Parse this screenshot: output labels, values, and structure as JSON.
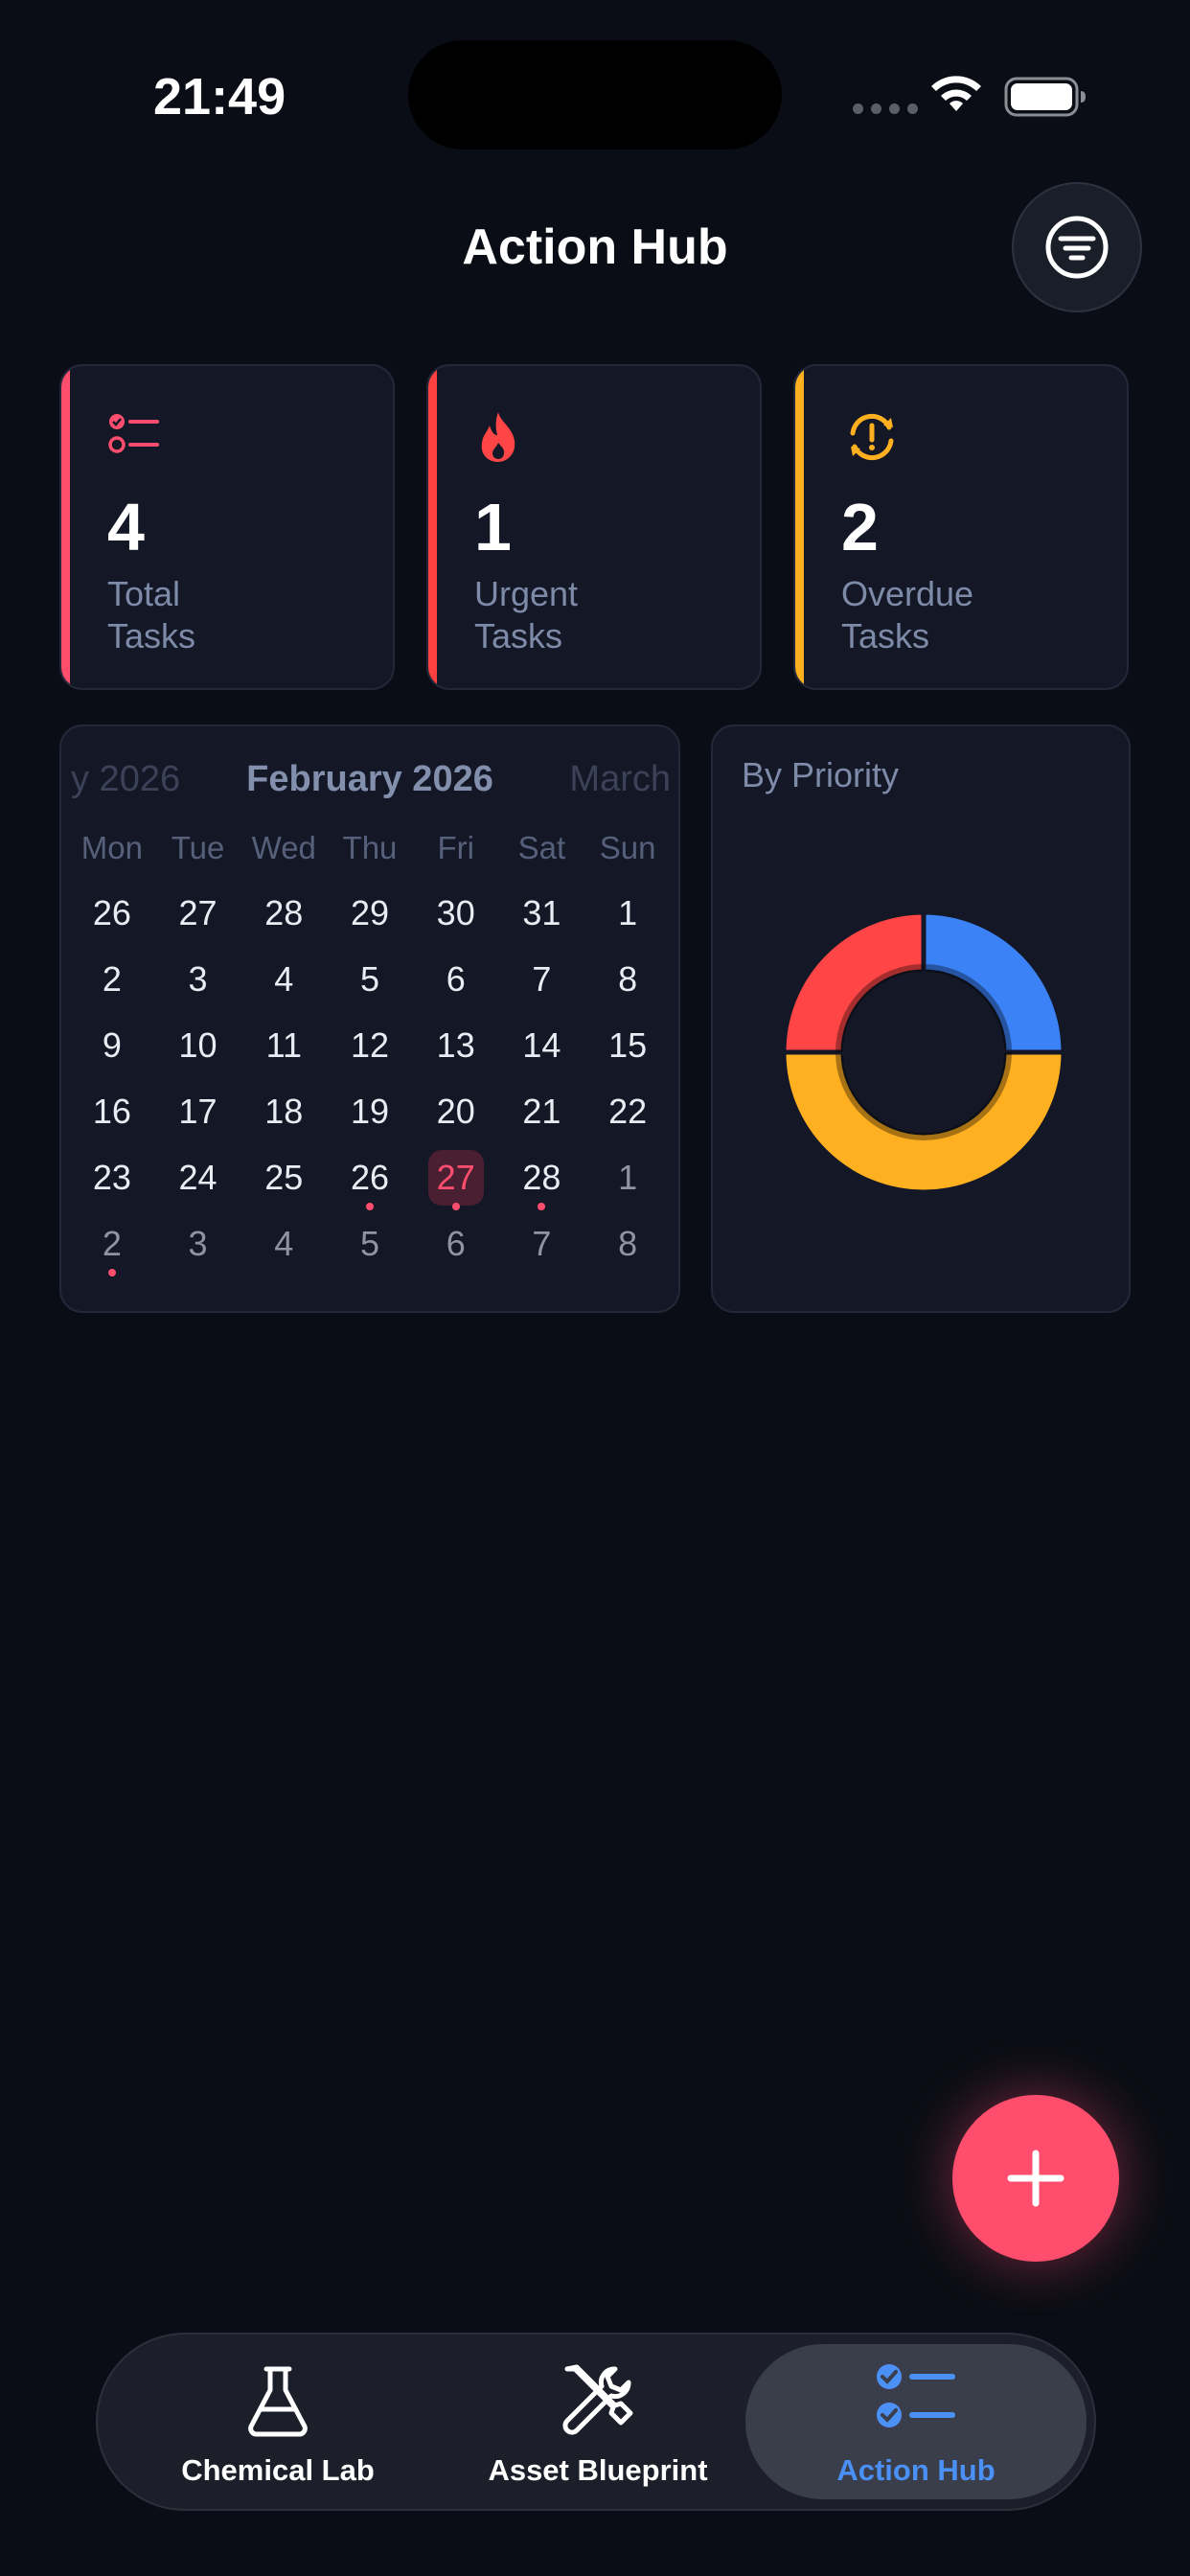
{
  "status_bar": {
    "time": "21:49"
  },
  "header": {
    "title": "Action Hub"
  },
  "stats": [
    {
      "value": "4",
      "label": "Total\nTasks",
      "accent": "#ff4d6d",
      "icon": "checklist-icon"
    },
    {
      "value": "1",
      "label": "Urgent\nTasks",
      "accent": "#ff4040",
      "icon": "fire-icon"
    },
    {
      "value": "2",
      "label": "Overdue\nTasks",
      "accent": "#ffb020",
      "icon": "overdue-cycle-icon"
    }
  ],
  "calendar": {
    "prev_month": "y 2026",
    "current_month": "February 2026",
    "next_month": "March",
    "weekdays": [
      "Mon",
      "Tue",
      "Wed",
      "Thu",
      "Fri",
      "Sat",
      "Sun"
    ],
    "days": [
      {
        "d": "26",
        "out": false
      },
      {
        "d": "27",
        "out": false
      },
      {
        "d": "28",
        "out": false
      },
      {
        "d": "29",
        "out": false
      },
      {
        "d": "30",
        "out": false
      },
      {
        "d": "31",
        "out": false
      },
      {
        "d": "1",
        "out": false
      },
      {
        "d": "2",
        "out": false
      },
      {
        "d": "3",
        "out": false
      },
      {
        "d": "4",
        "out": false
      },
      {
        "d": "5",
        "out": false
      },
      {
        "d": "6",
        "out": false
      },
      {
        "d": "7",
        "out": false
      },
      {
        "d": "8",
        "out": false
      },
      {
        "d": "9",
        "out": false
      },
      {
        "d": "10",
        "out": false
      },
      {
        "d": "11",
        "out": false
      },
      {
        "d": "12",
        "out": false
      },
      {
        "d": "13",
        "out": false
      },
      {
        "d": "14",
        "out": false
      },
      {
        "d": "15",
        "out": false
      },
      {
        "d": "16",
        "out": false
      },
      {
        "d": "17",
        "out": false
      },
      {
        "d": "18",
        "out": false
      },
      {
        "d": "19",
        "out": false
      },
      {
        "d": "20",
        "out": false
      },
      {
        "d": "21",
        "out": false
      },
      {
        "d": "22",
        "out": false
      },
      {
        "d": "23",
        "out": false
      },
      {
        "d": "24",
        "out": false
      },
      {
        "d": "25",
        "out": false
      },
      {
        "d": "26",
        "out": false,
        "dot": true
      },
      {
        "d": "27",
        "out": false,
        "today": true,
        "dot": true
      },
      {
        "d": "28",
        "out": false,
        "dot": true
      },
      {
        "d": "1",
        "out": true
      },
      {
        "d": "2",
        "out": true,
        "dot": true
      },
      {
        "d": "3",
        "out": true
      },
      {
        "d": "4",
        "out": true
      },
      {
        "d": "5",
        "out": true
      },
      {
        "d": "6",
        "out": true
      },
      {
        "d": "7",
        "out": true
      },
      {
        "d": "8",
        "out": true
      }
    ]
  },
  "priority": {
    "title": "By Priority",
    "chart_data": {
      "type": "pie",
      "values": [
        1,
        2,
        1
      ],
      "colors": [
        "#3b82f6",
        "#ffb020",
        "#ff4545"
      ]
    }
  },
  "tabs": [
    {
      "label": "Chemical Lab",
      "icon": "flask-icon",
      "active": false
    },
    {
      "label": "Asset Blueprint",
      "icon": "tools-icon",
      "active": false
    },
    {
      "label": "Action Hub",
      "icon": "checklist-icon",
      "active": true
    }
  ],
  "colors": {
    "accent": "#ff4d6d",
    "active_tab": "#4a90f5",
    "background": "#0a0d15"
  }
}
